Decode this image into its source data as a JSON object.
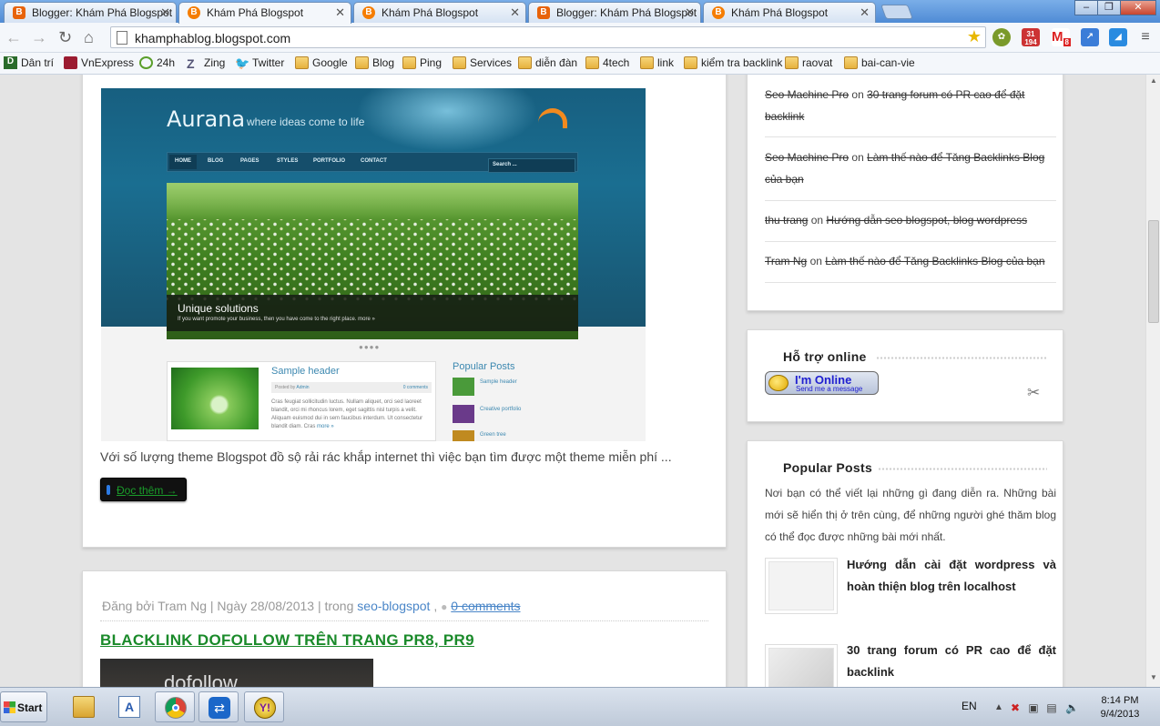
{
  "browser": {
    "tabs": [
      {
        "title": "Blogger: Khám Phá Blogspot",
        "icon": "blogger-icon",
        "active": false
      },
      {
        "title": "Khám Phá Blogspot",
        "icon": "blogger-icon",
        "active": true
      },
      {
        "title": "Khám Phá Blogspot",
        "icon": "blogger-icon",
        "active": false
      },
      {
        "title": "Blogger: Khám Phá Blogspot",
        "icon": "blogger-icon",
        "active": false
      },
      {
        "title": "Khám Phá Blogspot",
        "icon": "blogger-icon",
        "active": false
      }
    ],
    "url": "khamphablog.blogspot.com",
    "ext_badges": {
      "calendar": "194",
      "gmail": "8"
    },
    "bookmarks": [
      "Dân trí",
      "VnExpress",
      "24h",
      "Zing",
      "Twitter",
      "Google",
      "Blog",
      "Ping",
      "Services",
      "diễn đàn",
      "4tech",
      "link",
      "kiểm tra backlink",
      "raovat",
      "bai-can-vie"
    ]
  },
  "post1": {
    "screenshot": {
      "logo": "Aurana",
      "tagline": "where ideas come to life",
      "nav": [
        "HOME",
        "BLOG",
        "PAGES",
        "STYLES",
        "PORTFOLIO",
        "CONTACT"
      ],
      "search": "Search ...",
      "slide_title": "Unique solutions",
      "slide_text": "If you want promote your business, then you have come to the right place.",
      "slide_more": "more »",
      "sample_header": "Sample header",
      "posted_by": "Posted by",
      "posted_author": "Admin",
      "comments": "0 comments",
      "sample_text": "Cras feugiat sollicitudin luctus. Nullam aliquet, orci sed laoreet blandit, orci mi rhoncus lorem, eget sagittis nisl turpis a velit. Aliquam euismod dui in sem faucibus interdum. Ut consectetur blandit diam. Cras",
      "sample_more": "more »",
      "popular_title": "Popular Posts",
      "popular_items": [
        "Sample header",
        "Creative portfolio",
        "Green tree"
      ]
    },
    "excerpt": "Với số lượng  theme Blogspot  đồ sộ rải rác khắp internet thì việc bạn tìm được một theme miễn phí ...",
    "read_more": "Đọc thêm →"
  },
  "post2": {
    "meta_prefix": "Đăng bởi Tram Ng | Ngày 28/08/2013 | trong ",
    "category": "seo-blogspot",
    "separator": " , ",
    "comments": "0 comments",
    "title": "BLACKLINK DOFOLLOW TRÊN TRANG PR8, PR9",
    "image_text": "dofollow"
  },
  "sidebar": {
    "recent_comments": [
      {
        "user": "Seo Machine Pro",
        "on": " on ",
        "post": "30 trang forum có PR cao để đặt backlink"
      },
      {
        "user": "Seo Machine Pro",
        "on": " on ",
        "post": "Làm thế nào để Tăng Backlinks Blog của bạn"
      },
      {
        "user": "thu trang",
        "on": " on ",
        "post": "Hướng dẫn seo blogspot, blog wordpress"
      },
      {
        "user": "Tram Ng",
        "on": " on ",
        "post": "Làm thế nào để Tăng Backlinks Blog của bạn"
      }
    ],
    "support": {
      "title": "Hỗ trợ online",
      "status": "I'm Online",
      "status_sub": "Send me a message"
    },
    "popular": {
      "title": "Popular Posts",
      "description": "Nơi bạn có thể viết lại những gì đang diễn ra. Những bài mới sẽ hiển thị ở trên cùng, để những người ghé thăm blog có thể đọc được những bài mới nhất.",
      "items": [
        {
          "title": "Hướng dẫn cài đặt wordpress và hoàn thiện blog trên localhost"
        },
        {
          "title": "30 trang forum có PR cao để đặt backlink"
        }
      ]
    }
  },
  "taskbar": {
    "start": "Start",
    "lang": "EN",
    "time": "8:14 PM",
    "date": "9/4/2013",
    "apps": [
      "file-explorer",
      "wordpad",
      "chrome",
      "teamviewer",
      "yahoo-messenger"
    ]
  }
}
